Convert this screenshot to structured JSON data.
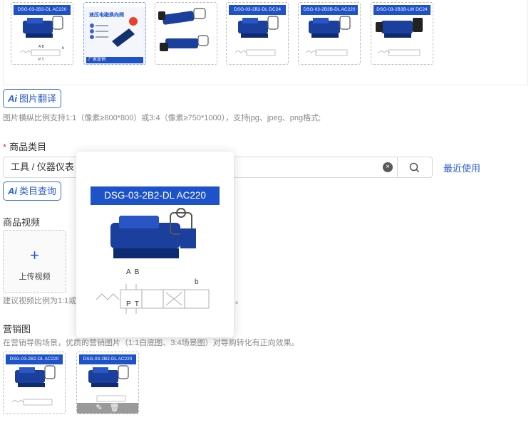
{
  "thumbnails": [
    {
      "banner": "DSG-03-2B2-DL  AC220",
      "type": "valve"
    },
    {
      "banner": "液压电磁换向阀",
      "type": "promo",
      "promo_footer": "厂家直销"
    },
    {
      "banner": "",
      "type": "double"
    },
    {
      "banner": "DSG-03-2B2-DL  DC24",
      "type": "valve"
    },
    {
      "banner": "DSG-03-2B3B-DL  AC220",
      "type": "valve"
    },
    {
      "banner": "DSG-03-2B3B-LW  DC24",
      "type": "valve"
    }
  ],
  "image_translate_btn": {
    "ai": "Ai",
    "label": "图片翻译"
  },
  "image_hint": "图片横纵比例支持1:1（像素≥800*800）或3:4（像素≥750*1000），支持jpg、jpeg、png格式;",
  "category": {
    "required_mark": "*",
    "label": "商品类目",
    "value": "工具 / 仪器仪表 /",
    "clear_icon": "×",
    "recent_label": "最近使用"
  },
  "category_query_btn": {
    "ai": "Ai",
    "label": "类目查询"
  },
  "video": {
    "label": "商品视频",
    "upload_plus": "+",
    "upload_label": "上传视频",
    "hint_left": "建议视频比例为1:1或",
    "hint_right": "。"
  },
  "marketing": {
    "label": "营销图",
    "hint": "在营销导购场景，优质的营销图片（1:1白底图、3:4场景图）对导购转化有正向效果。",
    "images": [
      {
        "banner": "DSG-03-2B2-DL  AC220"
      },
      {
        "banner": "DSG-03-2B2-DL  AC220"
      }
    ],
    "edit_icon": "✎",
    "delete_icon": "🗑"
  },
  "preview": {
    "banner": "DSG-03-2B2-DL  AC220",
    "port_top": "A  B",
    "port_bottom": "P  T",
    "port_b": "b"
  },
  "colors": {
    "accent": "#2a5bd3",
    "banner": "#1e52c8",
    "required": "#e5372b"
  }
}
